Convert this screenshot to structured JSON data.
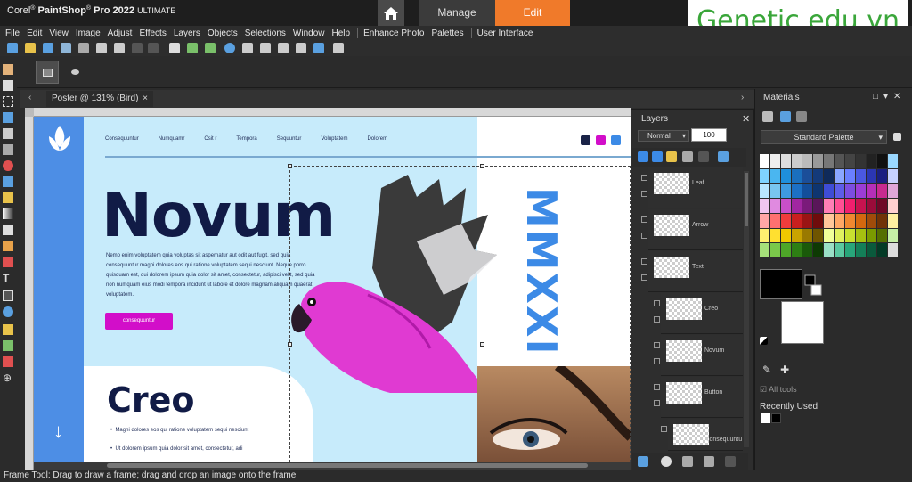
{
  "title": {
    "logo_corel": "Corel",
    "logo_reg": "®",
    "logo_psp": "PaintShop",
    "logo_reg2": "®",
    "logo_pro": "Pro 2022",
    "logo_ultimate": "ULTIMATE"
  },
  "workspace_tabs": {
    "manage": "Manage",
    "edit": "Edit"
  },
  "watermark": "Genetic.edu.vn",
  "menu": [
    "File",
    "Edit",
    "View",
    "Image",
    "Adjust",
    "Effects",
    "Layers",
    "Objects",
    "Selections",
    "Window",
    "Help",
    "Enhance Photo",
    "Palettes",
    "User Interface"
  ],
  "doc_tab": {
    "label": "Poster @ 131% (Bird)",
    "close": "×"
  },
  "poster": {
    "nav": [
      "Consequuntur",
      "Numquamr",
      "Csit r",
      "Tempora",
      "Sequuntur",
      "Voluptatem",
      "Dolorem"
    ],
    "headline": "Novum",
    "body": "Nemo enim voluptatem quia voluptas sit aspernatur aut odit aut fugit, sed quia consequuntur magni dolores eos qui ratione voluptatem sequi nesciunt. Neque porro quisquam est, qui dolorem ipsum quia dolor sit amet, consectetur, adipisci velit, sed quia non numquam eius modi tempora incidunt ut labore et dolore magnam aliquam quaerat voluptatem.",
    "cta": "consequuntur",
    "year": "MMXXI",
    "sub_headline": "Creo",
    "bullet1": "Magni dolores eos qui ratione voluptatem sequi nesciunt",
    "bullet2": "Ut dolorem ipsum quia dolor sit amet, consectetur, adi",
    "dot_colors": [
      "#1a2347",
      "#d20ec9",
      "#3c8ae6"
    ]
  },
  "status": "Frame Tool: Drag to draw a frame; drag and drop an image onto the frame",
  "layers": {
    "title": "Layers",
    "blend_mode": "Normal",
    "opacity": "100",
    "items": [
      "Leaf",
      "Arrow",
      "Text",
      "Creo",
      "Novum",
      "Button",
      "consequuntu"
    ]
  },
  "materials": {
    "title": "Materials",
    "palette": "Standard Palette",
    "all_tools": "All tools",
    "recently_used": "Recently Used"
  },
  "colors": {
    "accent": "#f07a2a",
    "brand_green": "#3aa63a"
  }
}
